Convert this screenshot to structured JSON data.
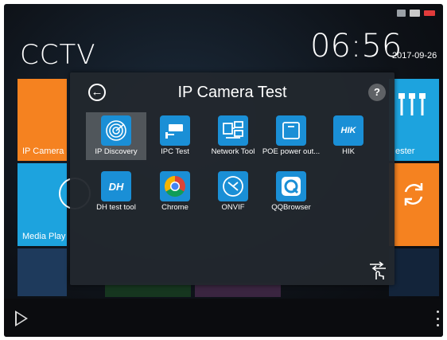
{
  "header": {
    "app_title": "CCTV",
    "time": "06:56",
    "date": "2017-09-26"
  },
  "status_icons": [
    "sim-icon",
    "usb-icon",
    "battery-icon"
  ],
  "background_tiles": {
    "ip_camera": "IP Camera",
    "media_player": "Media Play",
    "tester": "ester"
  },
  "dialog": {
    "title": "IP Camera Test",
    "help": "?",
    "apps": [
      {
        "label": "IP Discovery",
        "icon": "radar-icon",
        "selected": true
      },
      {
        "label": "IPC Test",
        "icon": "cctv-camera-icon"
      },
      {
        "label": "Network Tool",
        "icon": "network-icon"
      },
      {
        "label": "POE power out...",
        "icon": "poe-icon"
      },
      {
        "label": "HIK",
        "icon": "hik-icon",
        "icon_text": "HIK"
      },
      {
        "label": "DH test tool",
        "icon": "dh-icon",
        "icon_text": "DH"
      },
      {
        "label": "Chrome",
        "icon": "chrome-icon"
      },
      {
        "label": "ONVIF",
        "icon": "onvif-icon"
      },
      {
        "label": "QQBrowser",
        "icon": "qqbrowser-icon"
      }
    ]
  },
  "colors": {
    "orange": "#f58220",
    "blue": "#1da3de",
    "icon_blue": "#1a8fd6"
  }
}
